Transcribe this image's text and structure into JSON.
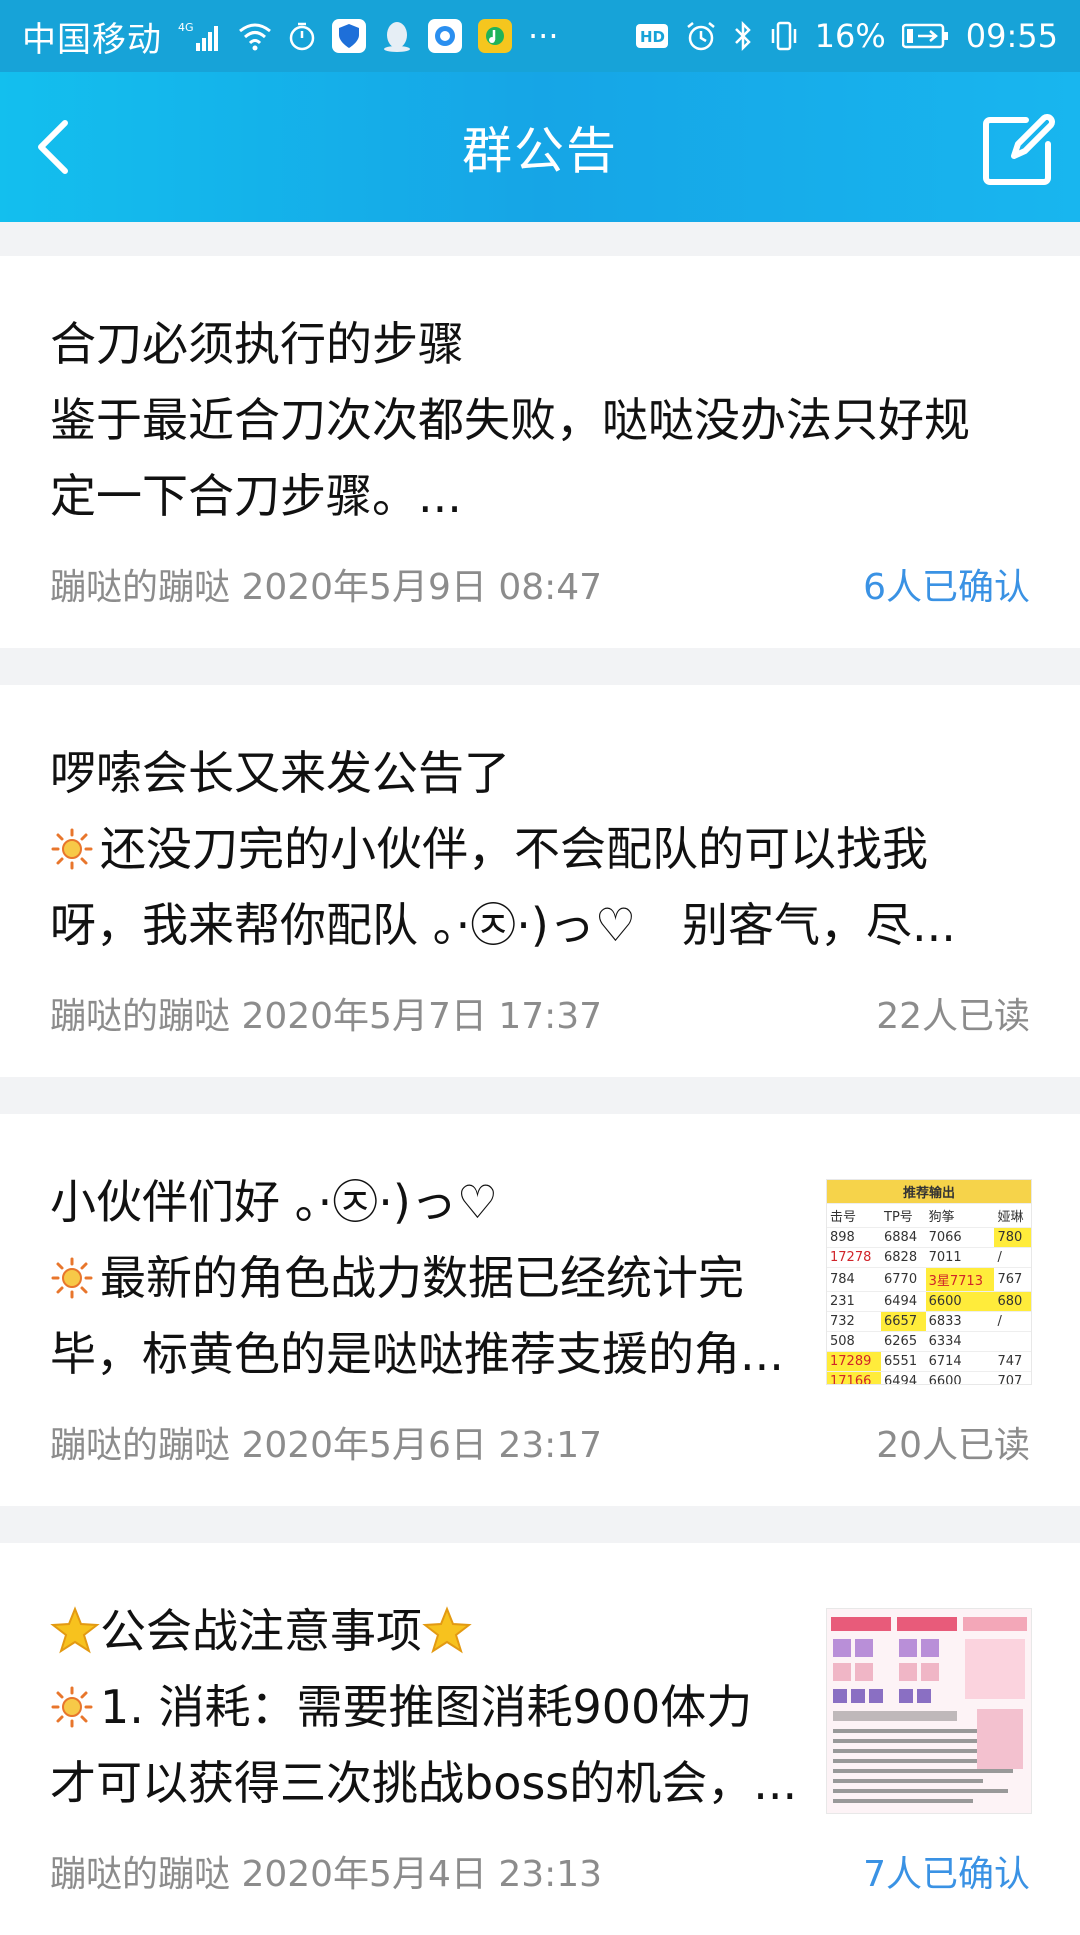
{
  "status": {
    "carrier": "中国移动",
    "network": "4G",
    "battery": "16%",
    "time": "09:55",
    "more": "···",
    "hd": "HD"
  },
  "header": {
    "title": "群公告"
  },
  "announcements": [
    {
      "title": "合刀必须执行的步骤",
      "line1": "鉴于最近合刀次次都失败，哒哒没办法只好规",
      "line2": "定一下合刀步骤。...",
      "meta": "蹦哒的蹦哒 2020年5月9日 08:47",
      "status": "6人已确认",
      "status_type": "confirm"
    },
    {
      "title": "啰嗦会长又来发公告了",
      "line1": "还没刀完的小伙伴，不会配队的可以找我",
      "line2": "呀，我来帮你配队 。·㉨·)っ♡　别客气，尽...",
      "meta": "蹦哒的蹦哒 2020年5月7日 17:37",
      "status": "22人已读",
      "status_type": "read"
    },
    {
      "title": "小伙伴们好 。·㉨·)っ♡",
      "line1": "最新的角色战力数据已经统计完",
      "line2": "毕，标黄色的是哒哒推荐支援的角...",
      "meta": "蹦哒的蹦哒 2020年5月6日 23:17",
      "status": "20人已读",
      "status_type": "read"
    },
    {
      "title": "公会战注意事项",
      "line1": "1. 消耗：需要推图消耗900体力",
      "line2": "才可以获得三次挑战boss的机会，...",
      "meta": "蹦哒的蹦哒 2020年5月4日 23:13",
      "status": "7人已确认",
      "status_type": "confirm"
    }
  ],
  "thumb_table": {
    "heading": "推荐输出",
    "cols": [
      "击号",
      "TP号",
      "狗筝",
      "娅琳"
    ],
    "rows": [
      [
        "898",
        "6884",
        "7066",
        "780"
      ],
      [
        "17278",
        "6828",
        "7011",
        "/"
      ],
      [
        "784",
        "6770",
        "3星7713",
        "767"
      ],
      [
        "231",
        "6494",
        "6600",
        "680"
      ],
      [
        "732",
        "6657",
        "6833",
        "/"
      ],
      [
        "508",
        "6265",
        "6334",
        ""
      ],
      [
        "17289",
        "6551",
        "6714",
        "747"
      ],
      [
        "17166",
        "6494",
        "6600",
        "707"
      ]
    ]
  },
  "colors": {
    "header_start": "#13bfee",
    "header_end": "#16a5e6",
    "confirm_text": "#3a92e4",
    "meta_text": "#8c8c8c"
  }
}
